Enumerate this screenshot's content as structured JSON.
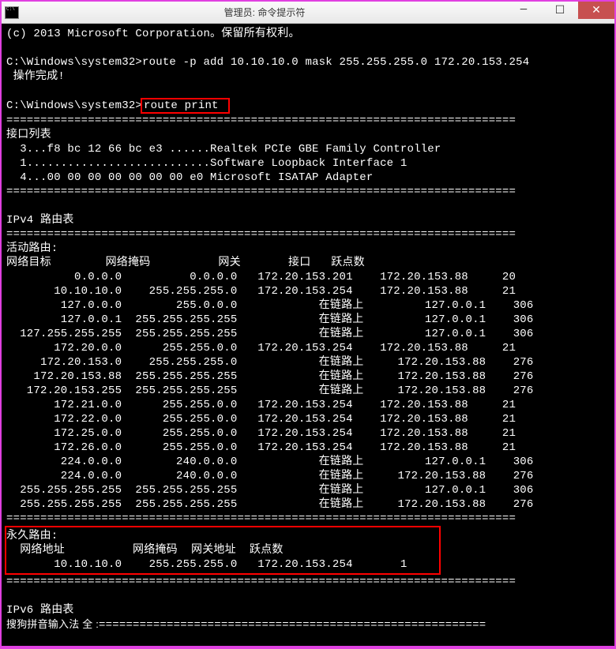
{
  "window": {
    "title": "管理员: 命令提示符"
  },
  "copyright": "(c) 2013 Microsoft Corporation。保留所有权利。",
  "prompt1": "C:\\Windows\\system32>",
  "cmd1": "route -p add 10.10.10.0 mask 255.255.255.0 172.20.153.254",
  "result1": " 操作完成!",
  "prompt2": "C:\\Windows\\system32>",
  "cmd2": "route print ",
  "divider": "===========================================================================",
  "interface_list_header": "接口列表",
  "interfaces": [
    "  3...f8 bc 12 66 bc e3 ......Realtek PCIe GBE Family Controller",
    "  1...........................Software Loopback Interface 1",
    "  4...00 00 00 00 00 00 00 e0 Microsoft ISATAP Adapter"
  ],
  "ipv4_header": "IPv4 路由表",
  "active_routes_header": "活动路由:",
  "route_columns": "网络目标        网络掩码          网关       接口   跃点数",
  "routes": [
    "          0.0.0.0          0.0.0.0   172.20.153.201    172.20.153.88     20",
    "       10.10.10.0    255.255.255.0   172.20.153.254    172.20.153.88     21",
    "        127.0.0.0        255.0.0.0            在链路上         127.0.0.1    306",
    "        127.0.0.1  255.255.255.255            在链路上         127.0.0.1    306",
    "  127.255.255.255  255.255.255.255            在链路上         127.0.0.1    306",
    "       172.20.0.0      255.255.0.0   172.20.153.254    172.20.153.88     21",
    "     172.20.153.0    255.255.255.0            在链路上     172.20.153.88    276",
    "    172.20.153.88  255.255.255.255            在链路上     172.20.153.88    276",
    "   172.20.153.255  255.255.255.255            在链路上     172.20.153.88    276",
    "       172.21.0.0      255.255.0.0   172.20.153.254    172.20.153.88     21",
    "       172.22.0.0      255.255.0.0   172.20.153.254    172.20.153.88     21",
    "       172.25.0.0      255.255.0.0   172.20.153.254    172.20.153.88     21",
    "       172.26.0.0      255.255.0.0   172.20.153.254    172.20.153.88     21",
    "        224.0.0.0        240.0.0.0            在链路上         127.0.0.1    306",
    "        224.0.0.0        240.0.0.0            在链路上     172.20.153.88    276",
    "  255.255.255.255  255.255.255.255            在链路上         127.0.0.1    306",
    "  255.255.255.255  255.255.255.255            在链路上     172.20.153.88    276"
  ],
  "persistent_header": "永久路由:",
  "persistent_columns": "  网络地址          网络掩码  网关地址  跃点数",
  "persistent_route": "       10.10.10.0    255.255.255.0   172.20.153.254       1",
  "ipv6_header": "IPv6 路由表",
  "ime_text": "搜狗拼音输入法 全 :"
}
